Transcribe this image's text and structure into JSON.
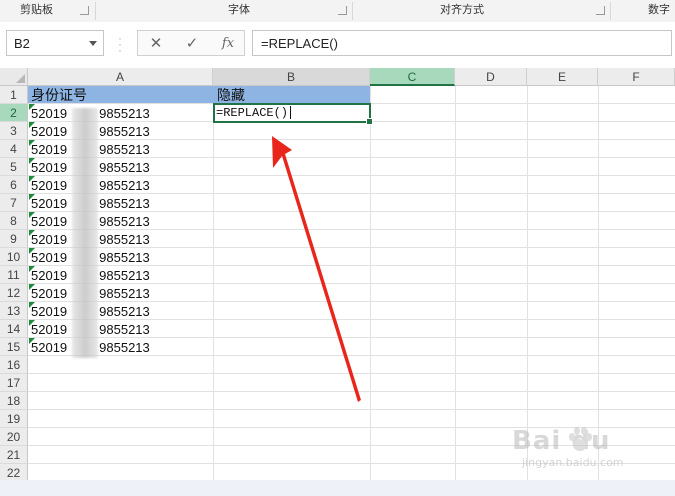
{
  "ribbon": {
    "groups": [
      "剪贴板",
      "字体",
      "对齐方式",
      "数字"
    ]
  },
  "formula_bar": {
    "cell_ref": "B2",
    "cancel_glyph": "✕",
    "enter_glyph": "✓",
    "fx_label": "fx",
    "formula": "=REPLACE()"
  },
  "columns": [
    "A",
    "B",
    "C",
    "D",
    "E",
    "F"
  ],
  "rows": [
    "1",
    "2",
    "3",
    "4",
    "5",
    "6",
    "7",
    "8",
    "9",
    "10",
    "11",
    "12",
    "13",
    "14",
    "15",
    "16",
    "17",
    "18",
    "19",
    "20",
    "21",
    "22"
  ],
  "sheet": {
    "header_a": "身份证号",
    "header_b": "隐藏",
    "active_cell_text": "=REPLACE()",
    "id_values": [
      {
        "left": "52019",
        "right": "9855213"
      },
      {
        "left": "52019",
        "right": "9855213"
      },
      {
        "left": "52019",
        "right": "9855213"
      },
      {
        "left": "52019",
        "right": "9855213"
      },
      {
        "left": "52019",
        "right": "9855213"
      },
      {
        "left": "52019",
        "right": "9855213"
      },
      {
        "left": "52019",
        "right": "9855213"
      },
      {
        "left": "52019",
        "right": "9855213"
      },
      {
        "left": "52019",
        "right": "9855213"
      },
      {
        "left": "52019",
        "right": "9855213"
      },
      {
        "left": "52019",
        "right": "9855213"
      },
      {
        "left": "52019",
        "right": "9855213"
      },
      {
        "left": "52019",
        "right": "9855213"
      },
      {
        "left": "52019",
        "right": "9855213"
      }
    ]
  },
  "watermark": {
    "brand": "Bai  du",
    "sub": "jingyan.baidu.com"
  },
  "colors": {
    "accent_green": "#217346",
    "header_fill": "#8db4e2",
    "arrow_red": "#e8261c"
  }
}
